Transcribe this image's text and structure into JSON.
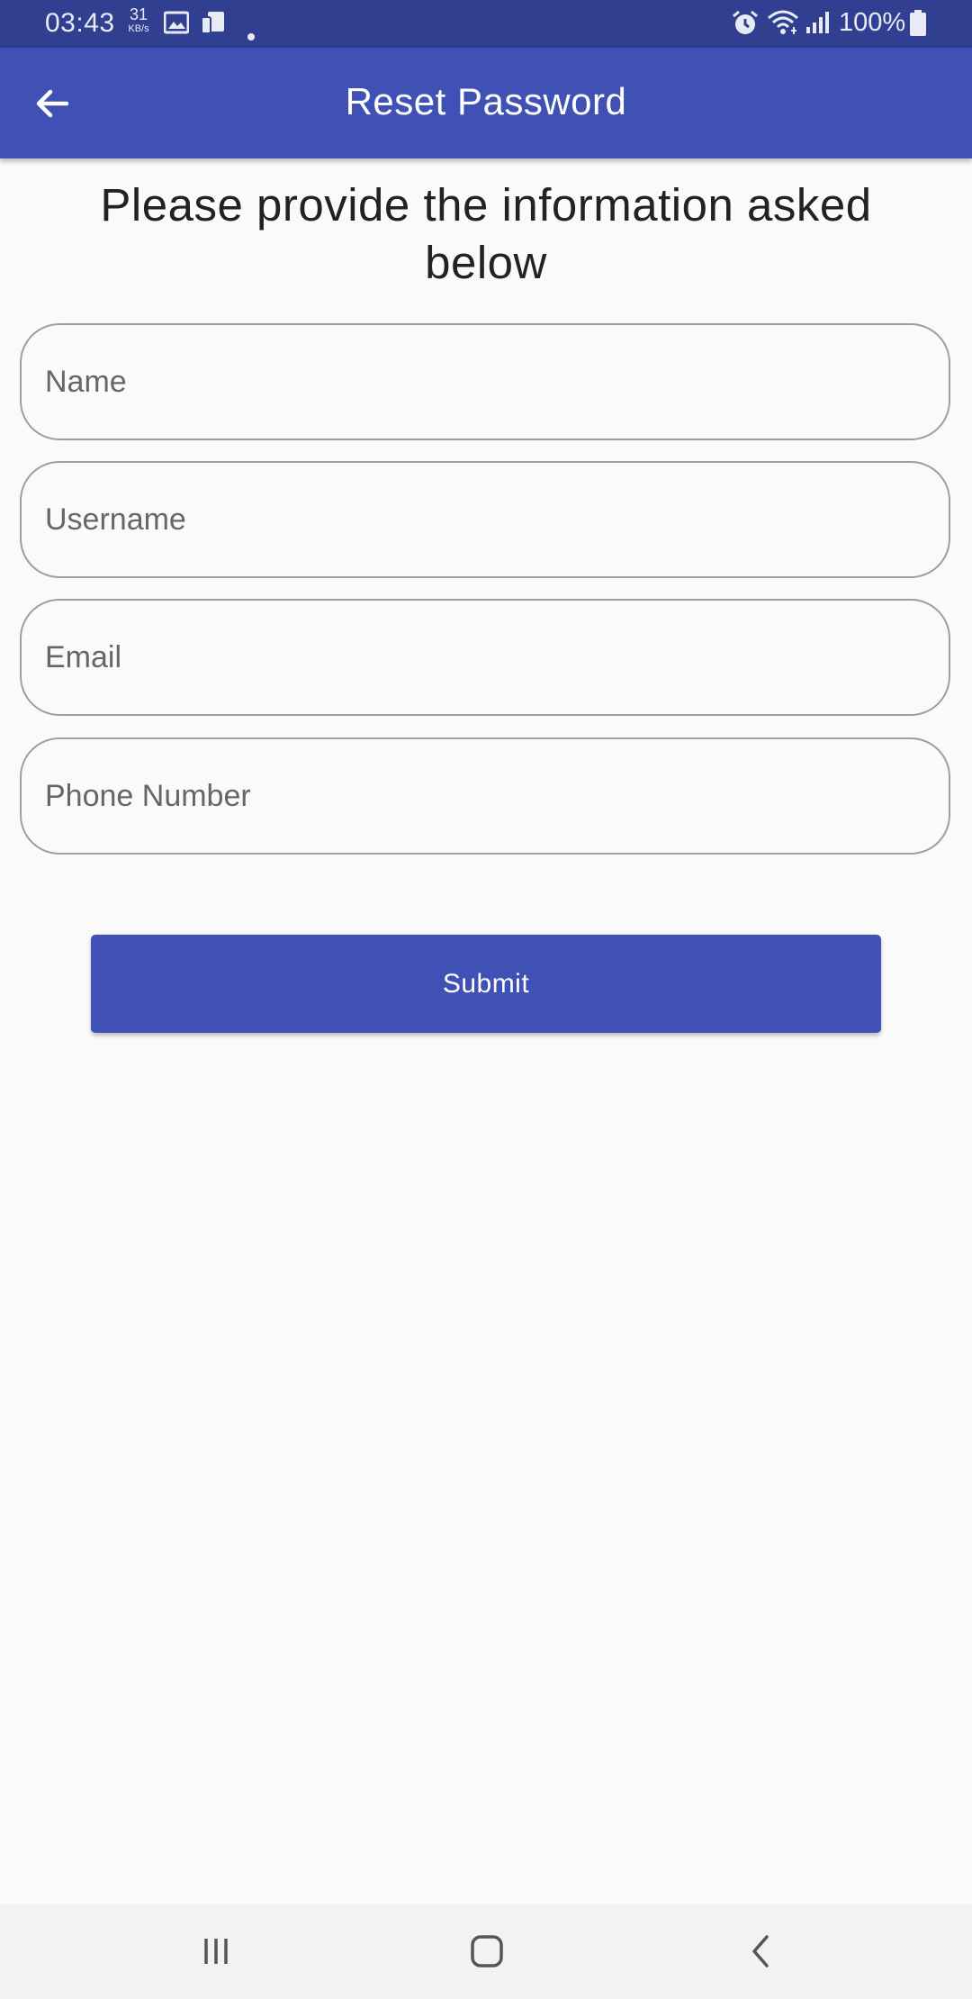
{
  "status_bar": {
    "time": "03:43",
    "net_speed_value": "31",
    "net_speed_unit": "KB/s",
    "battery": "100%",
    "icons": [
      "gallery-icon",
      "notification-icon",
      "dot-icon",
      "alarm-icon",
      "wifi-icon",
      "signal-icon",
      "battery-icon"
    ]
  },
  "app_bar": {
    "title": "Reset Password",
    "back_icon": "arrow-left-icon"
  },
  "form": {
    "heading": "Please provide the information asked below",
    "fields": {
      "name": {
        "placeholder": "Name",
        "value": ""
      },
      "username": {
        "placeholder": "Username",
        "value": ""
      },
      "email": {
        "placeholder": "Email",
        "value": ""
      },
      "phone": {
        "placeholder": "Phone Number",
        "value": ""
      }
    },
    "submit_label": "Submit"
  },
  "nav_bar": {
    "items": [
      "recent-apps-icon",
      "home-icon",
      "back-icon"
    ]
  },
  "colors": {
    "primary": "#3f51b5",
    "status_bar": "#303f8f",
    "background": "#fafafa",
    "field_border": "#9e9e9e"
  }
}
